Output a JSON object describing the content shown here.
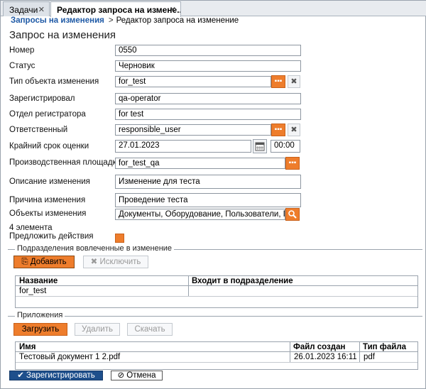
{
  "tabs": [
    {
      "label": "Задачи"
    },
    {
      "label": "Редактор запроса на измене..."
    }
  ],
  "breadcrumb": {
    "link": "Запросы на изменения",
    "separator": ">",
    "current": "Редактор запроса на изменение"
  },
  "page_title": "Запрос на изменения",
  "form": {
    "number": {
      "label": "Номер",
      "value": "0550"
    },
    "status": {
      "label": "Статус",
      "value": "Черновик"
    },
    "object_type": {
      "label": "Тип объекта изменения",
      "value": "for_test"
    },
    "registered_by": {
      "label": "Зарегистрировал",
      "value": "qa-operator"
    },
    "registrar_dept": {
      "label": "Отдел регистратора",
      "value": "for  test"
    },
    "responsible": {
      "label": "Ответственный",
      "value": "responsible_user"
    },
    "deadline": {
      "label": "Крайний срок оценки",
      "date": "27.01.2023",
      "time": "00:00"
    },
    "production_site": {
      "label": "Производственная площадка",
      "value": "for_test_qa"
    },
    "change_description": {
      "label": "Описание изменения",
      "value": "Изменение для теста"
    },
    "change_reason": {
      "label": "Причина изменения",
      "value": "Проведение теста"
    },
    "change_objects": {
      "label": "Объекты изменения",
      "value": "Документы, Оборудование, Пользователи, Под",
      "count_text": "4 элемента"
    },
    "propose_actions": {
      "label": "Предложить действия",
      "checked": true
    }
  },
  "departments": {
    "title": "Подразделения вовлеченные в изменение",
    "add_label": "Добавить",
    "exclude_label": "Исключить",
    "columns": [
      "Название",
      "Входит в подразделение"
    ],
    "rows": [
      {
        "name": "for_test",
        "parent": ""
      }
    ]
  },
  "attachments": {
    "title": "Приложения",
    "upload_label": "Загрузить",
    "delete_label": "Удалить",
    "download_label": "Скачать",
    "columns": [
      "Имя",
      "Файл создан",
      "Тип файла"
    ],
    "rows": [
      {
        "name": "Тестовый документ  1  2.pdf",
        "created": "26.01.2023 16:11",
        "type": "pdf"
      }
    ]
  },
  "footer": {
    "register_label": "Зарегистрировать",
    "cancel_label": "Отмена"
  },
  "colors": {
    "accent": "#ee7d2c",
    "link": "#1f5aa6",
    "primary_button": "#1e4f8c"
  },
  "icons": {
    "close": "close-icon",
    "lookup": "ellipsis-icon",
    "clear": "clear-icon",
    "calendar": "calendar-icon",
    "search": "search-icon",
    "check": "check-icon",
    "cancel": "cancel-icon"
  }
}
